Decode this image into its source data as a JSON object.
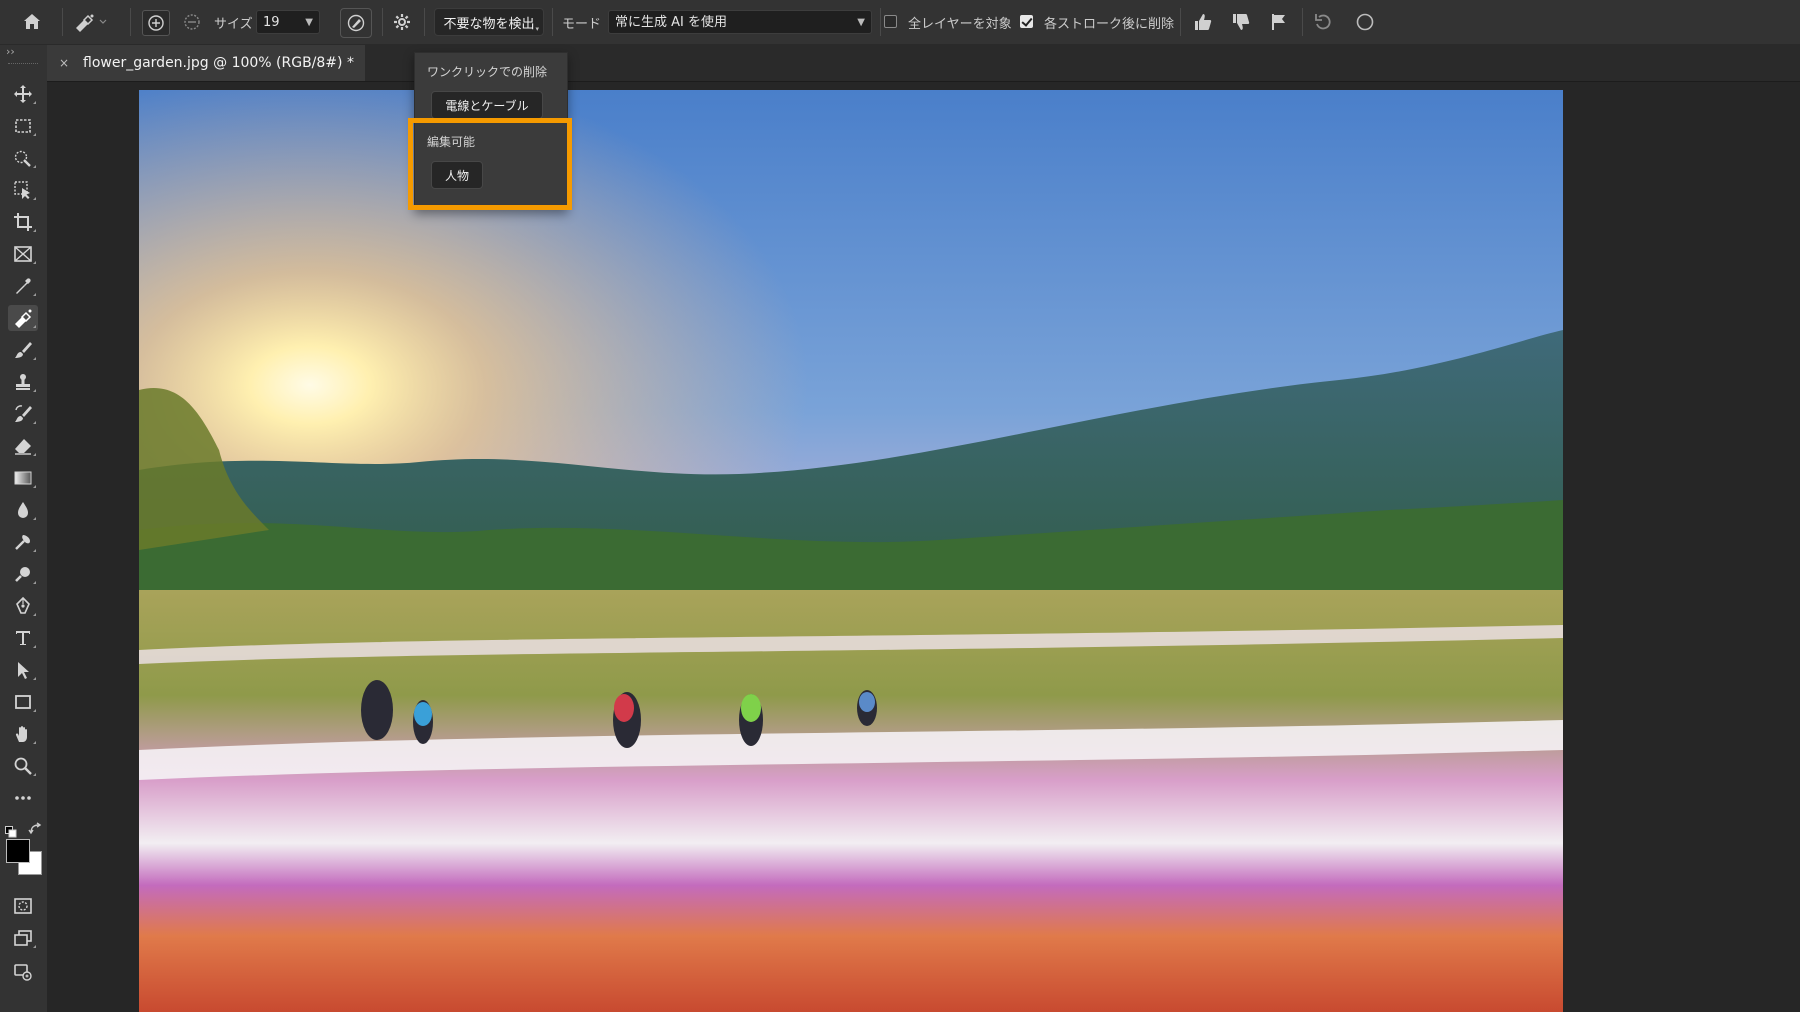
{
  "optionbar": {
    "size_label": "サイズ",
    "size_value": "19",
    "detect_button": "不要な物を検出",
    "mode_label": "モード",
    "mode_value": "常に生成 AI を使用",
    "all_layers_label": "全レイヤーを対象",
    "all_layers_checked": false,
    "delete_after_stroke_label": "各ストローク後に削除",
    "delete_after_stroke_checked": true
  },
  "document": {
    "tab_title": "flower_garden.jpg @ 100% (RGB/8#) *",
    "close_glyph": "×"
  },
  "dropdown": {
    "section1_label": "ワンクリックでの削除",
    "section1_button": "電線とケーブル",
    "section2_label": "編集可能",
    "section2_button": "人物"
  },
  "toolbar": {
    "collapse_glyph": "››",
    "active_tool": "remove-tool"
  },
  "colors": {
    "highlight": "#f59a00",
    "foreground": "#000000",
    "background": "#ffffff"
  }
}
